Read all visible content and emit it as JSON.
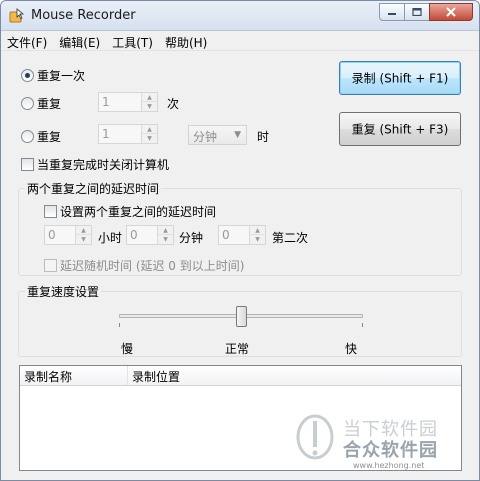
{
  "window": {
    "title": "Mouse Recorder"
  },
  "menu": [
    "文件(F)",
    "编辑(E)",
    "工具(T)",
    "帮助(H)"
  ],
  "repeat": {
    "once_label": "重复一次",
    "times_label": "重复",
    "times_value": "1",
    "times_unit": "次",
    "time_label": "重复",
    "time_value": "1",
    "time_unit_select": "分钟",
    "time_suffix": "时",
    "shutdown_label": "当重复完成时关闭计算机"
  },
  "buttons": {
    "record": "录制 (Shift + F1)",
    "repeat": "重复 (Shift + F3)"
  },
  "delay": {
    "group_title": "两个重复之间的延迟时间",
    "set_delay_label": "设置两个重复之间的延迟时间",
    "hours_value": "0",
    "hours_label": "小时",
    "minutes_value": "0",
    "minutes_label": "分钟",
    "seconds_value": "0",
    "seconds_label": "第二次",
    "random_label": "延迟随机时间 (延迟 0 到以上时间)"
  },
  "speed": {
    "group_title": "重复速度设置",
    "slow": "慢",
    "normal": "正常",
    "fast": "快",
    "level": 0.5
  },
  "list": {
    "columns": [
      "录制名称",
      "录制位置"
    ]
  },
  "watermark": {
    "line1": "当下软件园",
    "line2": "合众软件园",
    "url": "www.hezhong.net"
  }
}
